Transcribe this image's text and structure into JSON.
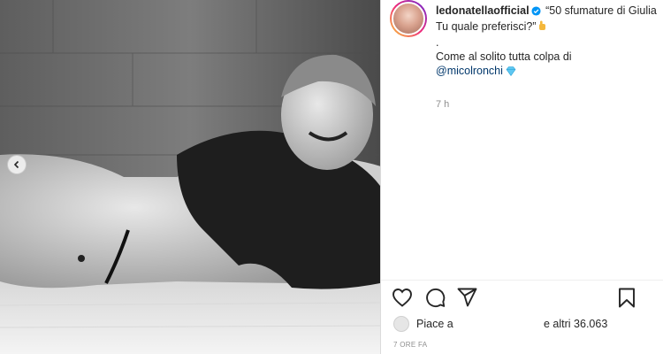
{
  "post": {
    "username": "ledonatellaofficial",
    "caption_line1": "“50 sfumature di Giulia",
    "caption_line2": "Tu quale preferisci?”",
    "caption_dot": ".",
    "caption_line3": "Come al solito tutta colpa di",
    "caption_mention": "@micolronchi",
    "caption_time": "7 h",
    "likes_prefix": "Piace a",
    "likes_suffix": "e altri 36.063",
    "post_time": "7 ORE FA"
  },
  "icons": {
    "carousel_prev": "chevron-left-icon",
    "verified": "verified-badge-icon",
    "hand": "pointing-hand-emoji",
    "gem": "gem-emoji",
    "like": "heart-icon",
    "comment": "comment-icon",
    "share": "send-icon",
    "save": "bookmark-icon"
  },
  "colors": {
    "text": "#262626",
    "muted": "#8e8e8e",
    "mention": "#00376b",
    "verified": "#0095f6"
  }
}
